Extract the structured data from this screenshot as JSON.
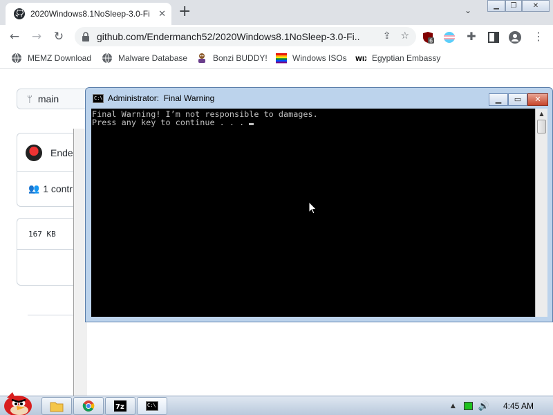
{
  "browser": {
    "tab_title": "2020Windows8.1NoSleep-3.0-Fi",
    "tab_close": "✕",
    "new_tab": "+",
    "tab_dropdown": "⌄",
    "url": "github.com/Endermanch52/2020Windows8.1NoSleep-3.0-Fi...",
    "ext_badge": "6",
    "bookmarks": [
      {
        "label": "MEMZ Download",
        "icon": "globe-icon"
      },
      {
        "label": "Malware Database",
        "icon": "globe-icon"
      },
      {
        "label": "Bonzi BUDDY!",
        "icon": "bonzi-icon"
      },
      {
        "label": "Windows ISOs",
        "icon": "windows-flag-icon"
      },
      {
        "label": "Egyptian Embassy",
        "icon": "wix-icon"
      }
    ]
  },
  "github": {
    "branch": "main",
    "owner": "Ender",
    "contributors": "1 contr",
    "size": "167 KB"
  },
  "console": {
    "title": "Administrator:  Final Warning",
    "lines": [
      "Final Warning! I’m not responsible to damages.",
      "Press any key to continue . . . "
    ],
    "btn_min": "▁",
    "btn_max": "▭",
    "btn_close": "✕"
  },
  "taskbar": {
    "clock": "4:45 AM",
    "items": [
      "explorer-icon",
      "chrome-icon",
      "7zip-icon",
      "cmd-icon"
    ]
  },
  "colors": {
    "console_bg": "#000000",
    "console_text": "#c0c0c0",
    "frame": "#bcd3ec"
  }
}
